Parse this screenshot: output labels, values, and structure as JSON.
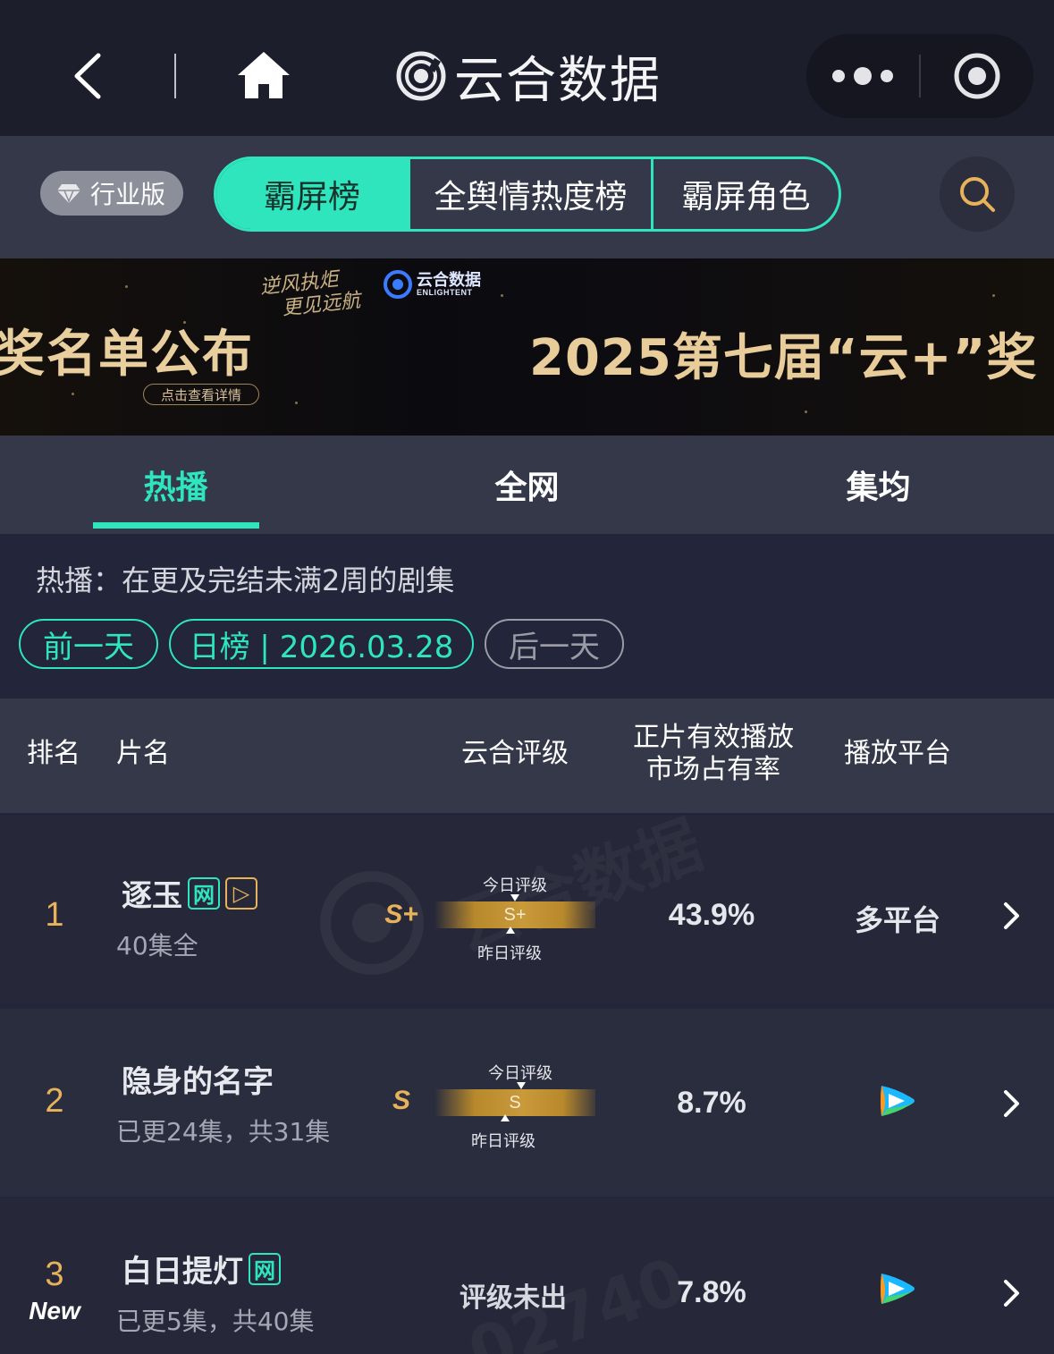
{
  "nav": {
    "brand_name": "云合数据"
  },
  "switchbar": {
    "edition_label": "行业版",
    "tabs": [
      {
        "label": "霸屏榜",
        "active": true
      },
      {
        "label": "全舆情热度榜",
        "active": false
      },
      {
        "label": "霸屏角色",
        "active": false
      }
    ]
  },
  "banner": {
    "headline": "奖名单公布",
    "cta": "点击查看详情",
    "slogan_line1": "逆风执炬",
    "slogan_line2": "更见远航",
    "logo_cn": "云合数据",
    "logo_en": "ENLIGHTENT",
    "title": "2025第七届“云+”奖"
  },
  "subtabs": [
    {
      "label": "热播",
      "active": true
    },
    {
      "label": "全网",
      "active": false
    },
    {
      "label": "集均",
      "active": false
    }
  ],
  "filter": {
    "description": "热播：在更及完结未满2周的剧集",
    "prev_label": "前一天",
    "date_label": "日榜 | 2026.03.28",
    "next_label": "后一天"
  },
  "table": {
    "headers": {
      "rank": "排名",
      "title": "片名",
      "grade": "云合评级",
      "share_line1": "正片有效播放",
      "share_line2": "市场占有率",
      "platform": "播放平台"
    },
    "today_grade_label": "今日评级",
    "yesterday_grade_label": "昨日评级",
    "rows": [
      {
        "rank": "1",
        "new": "",
        "title": "逐玉",
        "tag_net": "网",
        "tag_play": "▷",
        "sub": "40集全",
        "grade": "S+",
        "grade_bar": "S+",
        "share": "43.9%",
        "platform": "多平台"
      },
      {
        "rank": "2",
        "new": "",
        "title": "隐身的名字",
        "tag_net": "",
        "tag_play": "",
        "sub": "已更24集，共31集",
        "grade": "S",
        "grade_bar": "S",
        "share": "8.7%",
        "platform": "tencent-video-icon"
      },
      {
        "rank": "3",
        "new": "New",
        "title": "白日提灯",
        "tag_net": "网",
        "tag_play": "",
        "sub": "已更5集，共40集",
        "grade": "评级未出",
        "grade_bar": "",
        "share": "7.8%",
        "platform": "tencent-video-icon"
      }
    ]
  },
  "colors": {
    "accent": "#2ee5be",
    "gold": "#e7b25a",
    "background": "#23253a",
    "header_bg": "#353849"
  }
}
